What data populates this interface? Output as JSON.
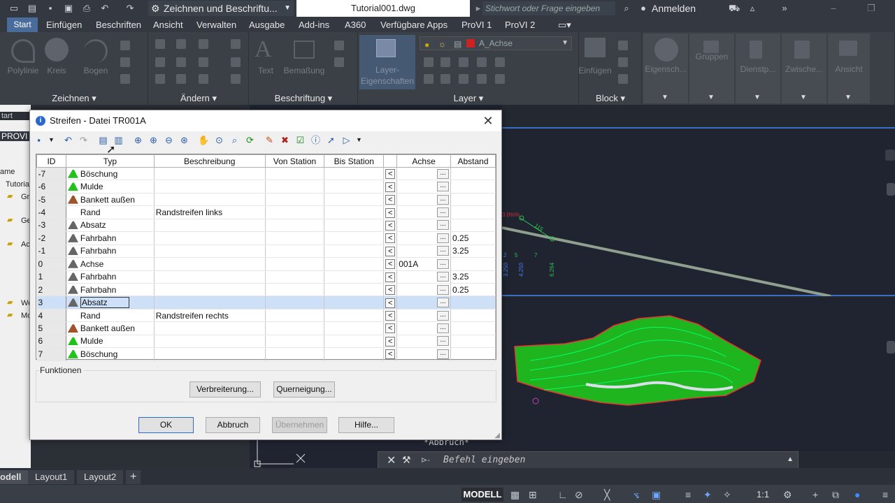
{
  "titlebar": {
    "workspace": "Zeichnen und Beschriftu...",
    "document": "Tutorial001.dwg",
    "search_placeholder": "Stichwort oder Frage eingeben",
    "signin": "Anmelden"
  },
  "menu": {
    "items": [
      "Start",
      "Einfügen",
      "Beschriften",
      "Ansicht",
      "Verwalten",
      "Ausgabe",
      "Add-ins",
      "A360",
      "Verfügbare Apps",
      "ProVI 1",
      "ProVI 2"
    ]
  },
  "ribbon": {
    "draw_tools": [
      "Polylinie",
      "Kreis",
      "Bogen"
    ],
    "text_tools": [
      "Text",
      "Bemaßung"
    ],
    "layer_tool": "Layer-\nEigenschaften",
    "layer_current": "A_Achse",
    "insert_tool": "Einfügen",
    "right_tools": [
      "Eigensch...",
      "Gruppen",
      "Dienstp...",
      "Zwische...",
      "Ansicht"
    ],
    "panels": [
      "Zeichnen",
      "Ändern",
      "Beschriftung",
      "Layer",
      "Block"
    ]
  },
  "leftpalette": {
    "labels": [
      "tart",
      "PROVI",
      "ame",
      "Tutoria",
      "Gr",
      "Ge",
      "Ac",
      "We",
      "Mo"
    ]
  },
  "canvas": {
    "labels": [
      "3.0%%",
      "115",
      "2",
      "5",
      "7",
      "3.250",
      "4.250",
      "6.264"
    ]
  },
  "commandline": {
    "placeholder": "Befehl eingeben",
    "last": "*Abbruch*"
  },
  "layout_tabs": [
    "odell",
    "Layout1",
    "Layout2"
  ],
  "status": {
    "mode": "MODELL",
    "scale": "1:1"
  },
  "dialog": {
    "title": "Streifen - Datei TR001A",
    "columns": [
      "ID",
      "Typ",
      "Beschreibung",
      "Von Station",
      "Bis Station",
      "",
      "Achse",
      "Abstand"
    ],
    "rows": [
      {
        "id": "-7",
        "typ": "Böschung",
        "icon": "boeschung-icon",
        "beschreibung": "",
        "achse": "",
        "abstand": ""
      },
      {
        "id": "-6",
        "typ": "Mulde",
        "icon": "mulde-icon",
        "beschreibung": "",
        "achse": "",
        "abstand": ""
      },
      {
        "id": "-5",
        "typ": "Bankett außen",
        "icon": "bankett-icon",
        "beschreibung": "",
        "achse": "",
        "abstand": ""
      },
      {
        "id": "-4",
        "typ": "Rand",
        "icon": "",
        "beschreibung": "Randstreifen links",
        "achse": "",
        "abstand": ""
      },
      {
        "id": "-3",
        "typ": "Absatz",
        "icon": "absatz-icon",
        "beschreibung": "",
        "achse": "",
        "abstand": ""
      },
      {
        "id": "-2",
        "typ": "Fahrbahn",
        "icon": "fahrbahn-icon",
        "beschreibung": "",
        "achse": "",
        "abstand": "0.25"
      },
      {
        "id": "-1",
        "typ": "Fahrbahn",
        "icon": "fahrbahn-icon",
        "beschreibung": "",
        "achse": "",
        "abstand": "3.25"
      },
      {
        "id": "0",
        "typ": "Achse",
        "icon": "achse-icon",
        "beschreibung": "",
        "achse": "001A",
        "abstand": ""
      },
      {
        "id": "1",
        "typ": "Fahrbahn",
        "icon": "fahrbahn-icon",
        "beschreibung": "",
        "achse": "",
        "abstand": "3.25"
      },
      {
        "id": "2",
        "typ": "Fahrbahn",
        "icon": "fahrbahn-icon",
        "beschreibung": "",
        "achse": "",
        "abstand": "0.25"
      },
      {
        "id": "3",
        "typ": "Absatz",
        "icon": "absatz-icon",
        "beschreibung": "",
        "achse": "",
        "abstand": "",
        "selected": true
      },
      {
        "id": "4",
        "typ": "Rand",
        "icon": "",
        "beschreibung": "Randstreifen rechts",
        "achse": "",
        "abstand": ""
      },
      {
        "id": "5",
        "typ": "Bankett außen",
        "icon": "bankett-icon",
        "beschreibung": "",
        "achse": "",
        "abstand": ""
      },
      {
        "id": "6",
        "typ": "Mulde",
        "icon": "mulde-icon",
        "beschreibung": "",
        "achse": "",
        "abstand": ""
      },
      {
        "id": "7",
        "typ": "Böschung",
        "icon": "boeschung-icon",
        "beschreibung": "",
        "achse": "",
        "abstand": ""
      }
    ],
    "functions_label": "Funktionen",
    "btn_verbreiterung": "Verbreiterung...",
    "btn_querneigung": "Querneigung...",
    "btn_ok": "OK",
    "btn_abbruch": "Abbruch",
    "btn_uebernehmen": "Übernehmen",
    "btn_hilfe": "Hilfe...",
    "icon_colors": {
      "green": "#22c21c",
      "brown": "#a0522d",
      "gray": "#666666"
    }
  }
}
